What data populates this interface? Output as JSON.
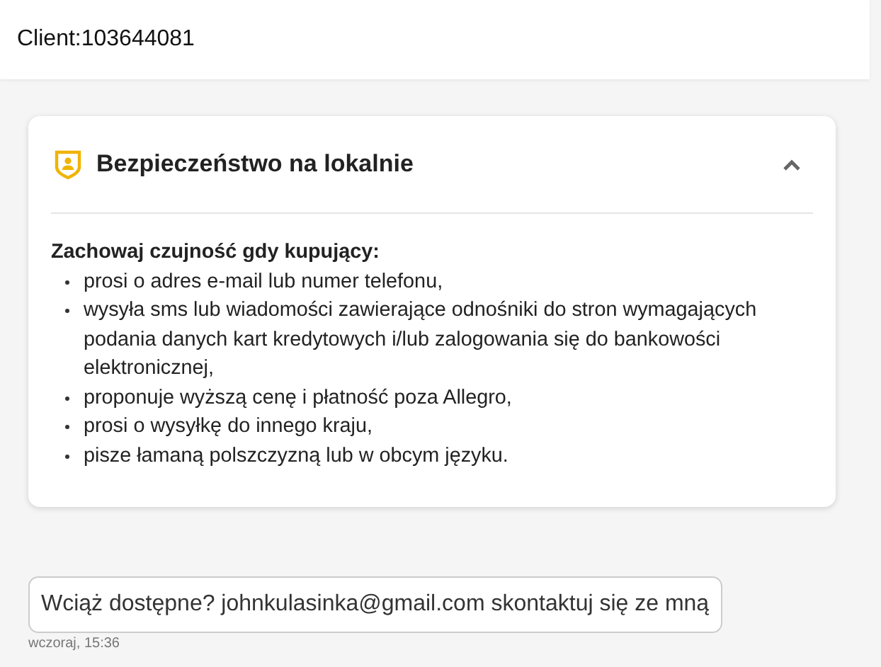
{
  "header": {
    "client": "Client:103644081"
  },
  "safety_panel": {
    "title": "Bezpieczeństwo na lokalnie",
    "expanded": true,
    "intro": "Zachowaj czujność gdy kupujący:",
    "items": [
      "prosi o adres e-mail lub numer telefonu,",
      "wysyła sms lub wiadomości zawierające odnośniki do stron wymagających podania danych kart kredytowych i/lub zalogowania się do bankowości elektronicznej,",
      "proponuje wyższą cenę i płatność poza Allegro,",
      "prosi o wysyłkę do innego kraju,",
      "pisze łamaną polszczyzną lub w obcym języku."
    ]
  },
  "messages": [
    {
      "text": "Wciąż dostępne? johnkulasinka@gmail.com skontaktuj się ze mną",
      "time": "wczoraj, 15:36"
    }
  ]
}
